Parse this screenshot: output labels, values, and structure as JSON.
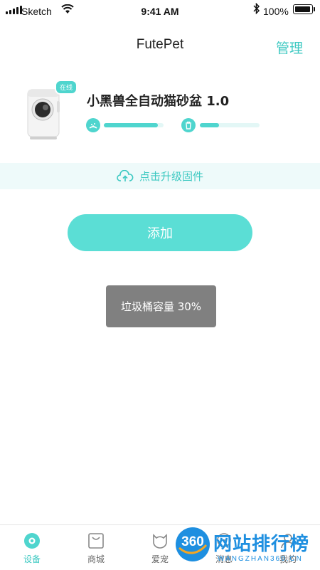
{
  "status_bar": {
    "carrier": "Sketch",
    "time": "9:41 AM",
    "battery_pct": "100%",
    "battery_level": 1.0
  },
  "nav": {
    "title": "FutePet",
    "manage": "管理"
  },
  "device": {
    "online_badge": "在线",
    "name": "小黑兽全自动猫砂盆 1.0",
    "litter_level": 0.9,
    "trash_level": 0.32,
    "litter_icon": "litter-icon",
    "trash_icon": "trash-bin-icon"
  },
  "firmware": {
    "label": "点击升级固件",
    "icon": "cloud-upload-icon"
  },
  "add_button": "添加",
  "toast": "垃圾桶容量 30%",
  "tabs": [
    {
      "label": "设备",
      "icon": "device-icon",
      "active": true
    },
    {
      "label": "商城",
      "icon": "shop-bag-icon",
      "active": false
    },
    {
      "label": "爱宠",
      "icon": "pet-icon",
      "active": false
    },
    {
      "label": "消息",
      "icon": "message-icon",
      "active": false
    },
    {
      "label": "我的",
      "icon": "profile-icon",
      "active": false
    }
  ],
  "watermark": {
    "badge": "360",
    "title": "网站排行榜",
    "sub": "WANGZHAN360.CN"
  },
  "colors": {
    "accent": "#4fd5ce",
    "accent_text": "#3ec9c2",
    "button": "#5bded5",
    "toast_bg": "#808080"
  }
}
